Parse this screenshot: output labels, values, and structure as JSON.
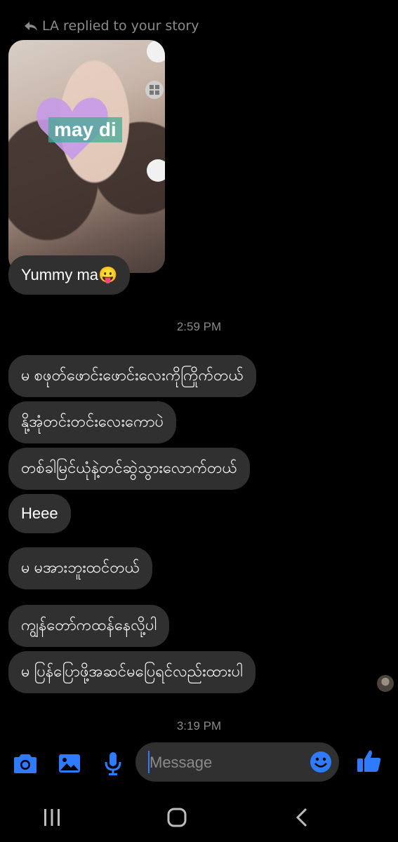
{
  "reply_note": "LA replied to your story",
  "story": {
    "sticker_text": "may di"
  },
  "first_message": "Yummy ma😛",
  "time1": "2:59 PM",
  "messages": [
    "မ စဖုတ်ဖောင်းဖောင်းလေးကိုကြိုက်တယ်",
    "နို့အုံတင်းတင်းလေးကောပဲ",
    "တစ်ခါမြင်ယုံနဲ့တင်ဆွဲသွားလောက်တယ်",
    "Heee",
    "မ မအားဘူးထင်တယ်",
    "ကျွန်တော်ကထန်နေလို့ပါ",
    "မ ပြန်ပြောဖို့အဆင်မပြေရင်လည်းထားပါ"
  ],
  "time2": "3:19 PM",
  "composer": {
    "placeholder": "Message"
  },
  "colors": {
    "accent": "#2f7bff",
    "bubble": "#303030",
    "muted": "#8a8a8a"
  },
  "icons": [
    "camera-icon",
    "gallery-icon",
    "microphone-icon",
    "emoji-icon",
    "thumbs-up-icon",
    "recent-apps-icon",
    "home-icon",
    "back-icon"
  ]
}
